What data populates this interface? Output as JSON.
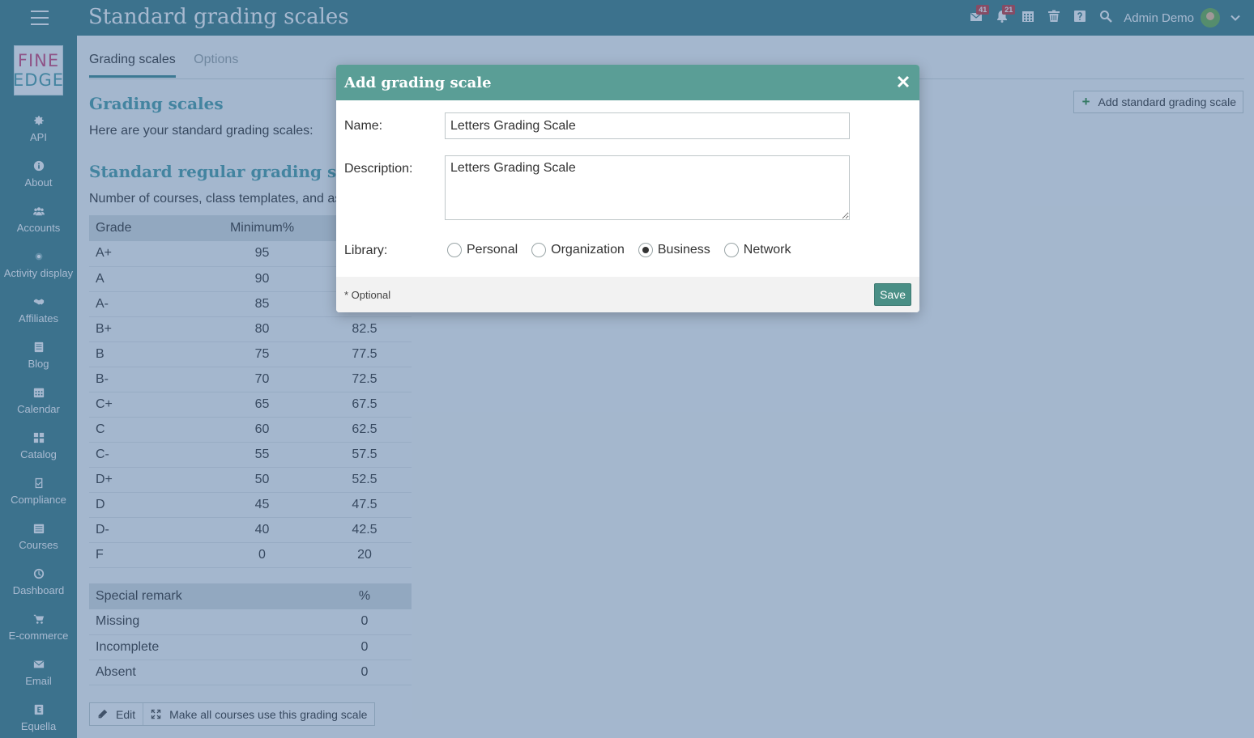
{
  "header": {
    "title": "Standard grading scales",
    "messages_badge": "41",
    "notifications_badge": "21",
    "user_name": "Admin Demo"
  },
  "logo": {
    "line1": "FINE",
    "line2": "EDGE"
  },
  "sidebar": {
    "items": [
      {
        "label": "API",
        "icon": "gear-icon"
      },
      {
        "label": "About",
        "icon": "info-icon"
      },
      {
        "label": "Accounts",
        "icon": "users-icon"
      },
      {
        "label": "Activity display",
        "icon": "dot-icon"
      },
      {
        "label": "Affiliates",
        "icon": "handshake-icon"
      },
      {
        "label": "Blog",
        "icon": "blog-icon"
      },
      {
        "label": "Calendar",
        "icon": "calendar-icon"
      },
      {
        "label": "Catalog",
        "icon": "grid-icon"
      },
      {
        "label": "Compliance",
        "icon": "checklist-icon"
      },
      {
        "label": "Courses",
        "icon": "courses-icon"
      },
      {
        "label": "Dashboard",
        "icon": "dashboard-icon"
      },
      {
        "label": "E-commerce",
        "icon": "cart-icon"
      },
      {
        "label": "Email",
        "icon": "envelope-icon"
      },
      {
        "label": "Equella",
        "icon": "equella-icon"
      }
    ]
  },
  "tabs": [
    {
      "label": "Grading scales",
      "active": true
    },
    {
      "label": "Options",
      "active": false
    }
  ],
  "content": {
    "grading_heading": "Grading scales",
    "intro": "Here are your standard grading scales:",
    "add_button": "Add standard grading scale",
    "standard_heading": "Standard regular grading scale",
    "count_text": "Number of courses, class templates, and as",
    "grade_table": {
      "headers": [
        "Grade",
        "Minimum%",
        ""
      ],
      "rows": [
        [
          "A+",
          "95",
          ""
        ],
        [
          "A",
          "90",
          ""
        ],
        [
          "A-",
          "85",
          ""
        ],
        [
          "B+",
          "80",
          "82.5"
        ],
        [
          "B",
          "75",
          "77.5"
        ],
        [
          "B-",
          "70",
          "72.5"
        ],
        [
          "C+",
          "65",
          "67.5"
        ],
        [
          "C",
          "60",
          "62.5"
        ],
        [
          "C-",
          "55",
          "57.5"
        ],
        [
          "D+",
          "50",
          "52.5"
        ],
        [
          "D",
          "45",
          "47.5"
        ],
        [
          "D-",
          "40",
          "42.5"
        ],
        [
          "F",
          "0",
          "20"
        ]
      ]
    },
    "remarks_table": {
      "headers": [
        "Special remark",
        "%"
      ],
      "rows": [
        [
          "Missing",
          "0"
        ],
        [
          "Incomplete",
          "0"
        ],
        [
          "Absent",
          "0"
        ]
      ]
    },
    "actions": {
      "edit": "Edit",
      "make_all": "Make all courses use this grading scale"
    }
  },
  "modal": {
    "title": "Add grading scale",
    "name_label": "Name:",
    "name_value": "Letters Grading Scale",
    "description_label": "Description:",
    "description_value": "Letters Grading Scale",
    "library_label": "Library:",
    "library_options": [
      {
        "label": "Personal",
        "selected": false
      },
      {
        "label": "Organization",
        "selected": false
      },
      {
        "label": "Business",
        "selected": true
      },
      {
        "label": "Network",
        "selected": false
      }
    ],
    "optional_note": "* Optional",
    "save_label": "Save"
  },
  "colors": {
    "brand": "#3d7f86",
    "modal_header": "#5a9e96",
    "heading": "#4a9fa8",
    "badge": "#c5393d",
    "save": "#4a8f86"
  }
}
